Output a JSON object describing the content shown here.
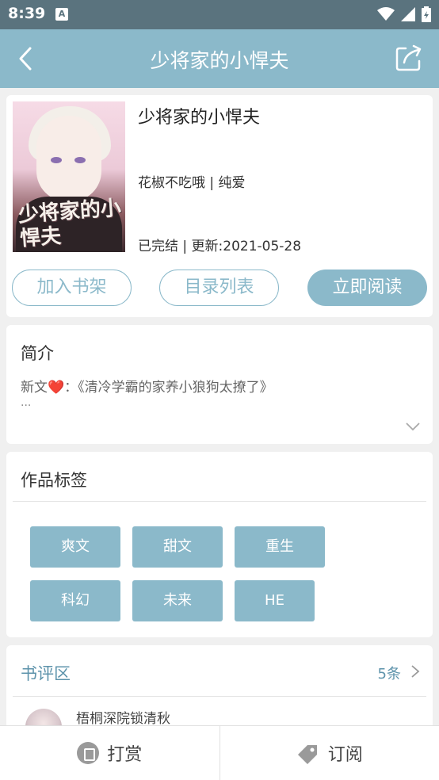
{
  "status_bar": {
    "time": "8:39",
    "notification_badge": "A"
  },
  "appbar": {
    "title": "少将家的小悍夫"
  },
  "book": {
    "title": "少将家的小悍夫",
    "author_line": "花椒不吃哦 | 纯爱",
    "status_line": "已完结 | 更新:2021-05-28",
    "cover_text": "少将家的小悍夫"
  },
  "actions": {
    "add_shelf": "加入书架",
    "catalog": "目录列表",
    "read_now": "立即阅读"
  },
  "intro": {
    "title": "简介",
    "text": "新文❤️：《清冷学霸的家养小狼狗太撩了》",
    "more": "..."
  },
  "tags": {
    "title": "作品标签",
    "items": [
      "爽文",
      "甜文",
      "重生",
      "科幻",
      "未来",
      "HE"
    ]
  },
  "reviews": {
    "title": "书评区",
    "count": "5条",
    "first_reviewer": "梧桐深院锁清秋"
  },
  "bottom": {
    "reward": "打赏",
    "subscribe": "订阅"
  },
  "colors": {
    "accent": "#8bb9ca",
    "status_bar": "#5a737e",
    "review_accent": "#5d93ab"
  }
}
